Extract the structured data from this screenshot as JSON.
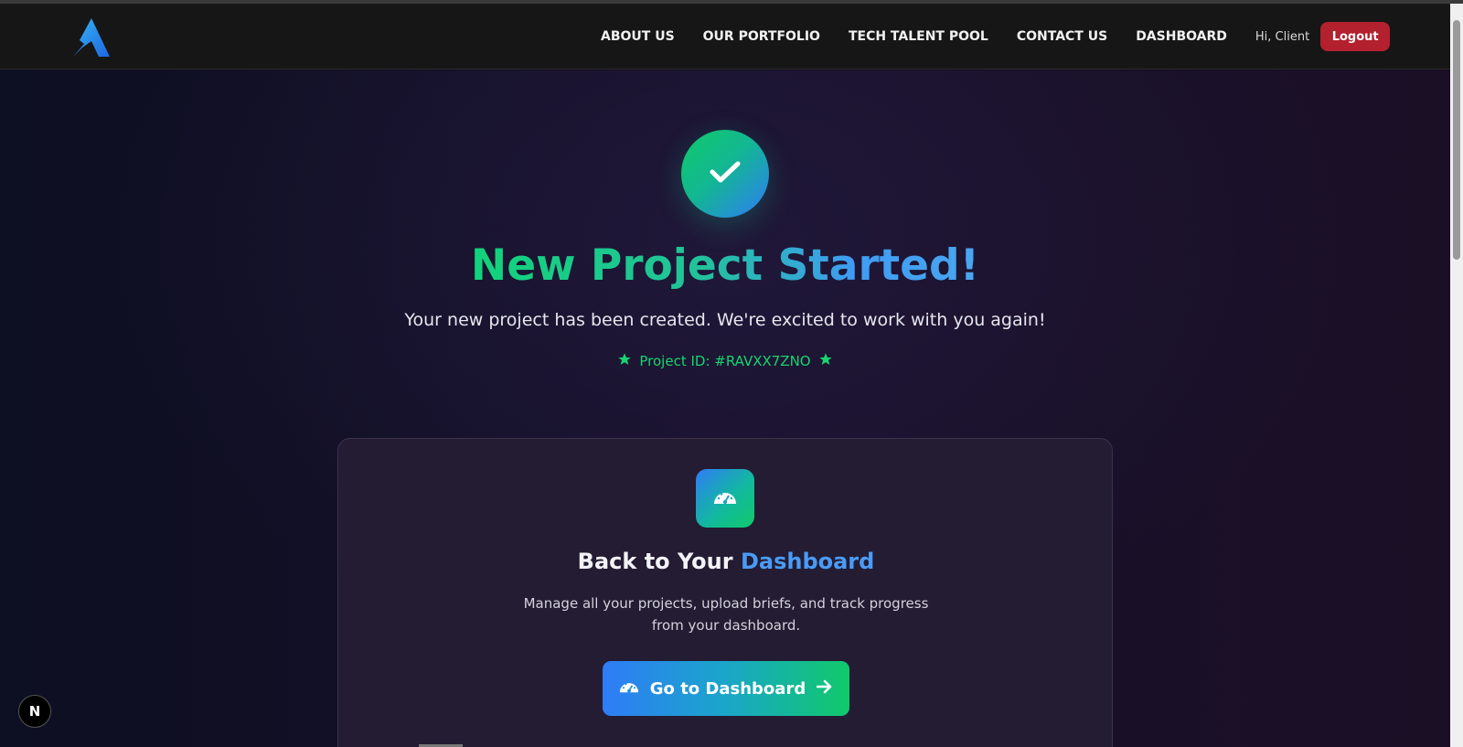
{
  "nav": {
    "links": [
      "ABOUT US",
      "OUR PORTFOLIO",
      "TECH TALENT POOL",
      "CONTACT US",
      "DASHBOARD"
    ],
    "greeting": "Hi, Client",
    "logout_label": "Logout"
  },
  "hero": {
    "title": "New Project Started!",
    "subtitle": "Your new project has been created. We're excited to work with you again!",
    "project_id": "Project ID: #RAVXX7ZNO"
  },
  "card": {
    "title_prefix": "Back to Your ",
    "title_accent": "Dashboard",
    "desc_line1": "Manage all your projects, upload briefs, and track progress",
    "desc_line2": "from your dashboard.",
    "button_label": "Go to Dashboard"
  },
  "next_badge": "N",
  "colors": {
    "accent_green": "#17d46f",
    "accent_blue": "#4a9bf5",
    "logout_red": "#b3202e"
  }
}
